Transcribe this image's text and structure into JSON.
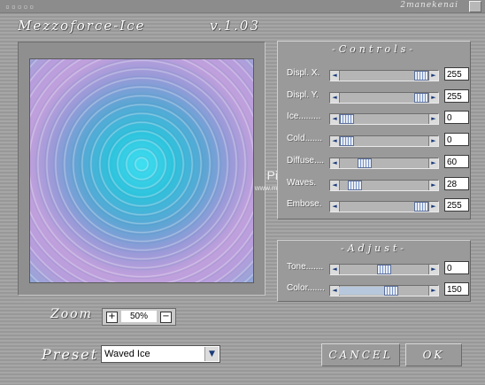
{
  "window": {
    "title_dots": "▫▫▫▫▫",
    "brand": "2manekenai"
  },
  "header": {
    "app_name": "Mezzoforce-Ice",
    "version": "v.1.03"
  },
  "watermark": {
    "text": "Pinuccia",
    "url": "www.maidiregrafica.eu"
  },
  "controls": {
    "title": "-Controls-",
    "rows": [
      {
        "label": "Displ. X.",
        "value": "255",
        "level": 1.0
      },
      {
        "label": "Displ. Y.",
        "value": "255",
        "level": 1.0
      },
      {
        "label": "Ice.........",
        "value": "0",
        "level": 0.0
      },
      {
        "label": "Cold.......",
        "value": "0",
        "level": 0.0
      },
      {
        "label": "Diffuse....",
        "value": "60",
        "level": 0.235
      },
      {
        "label": "Waves.",
        "value": "28",
        "level": 0.11
      },
      {
        "label": "Embose.",
        "value": "255",
        "level": 1.0
      }
    ]
  },
  "adjust": {
    "title": "-Adjust-",
    "rows": [
      {
        "label": "Tone.......",
        "value": "0",
        "level": 0.5
      },
      {
        "label": "Color.......",
        "value": "150",
        "level": 0.59
      }
    ]
  },
  "zoom": {
    "label": "Zoom",
    "value": "50%",
    "plus": "+",
    "minus": "−"
  },
  "preset": {
    "label": "Preset",
    "value": "Waved Ice"
  },
  "buttons": {
    "cancel": "CANCEL",
    "ok": "OK"
  },
  "icons": {
    "left": "◄",
    "right": "►",
    "dropdown": "▼"
  }
}
